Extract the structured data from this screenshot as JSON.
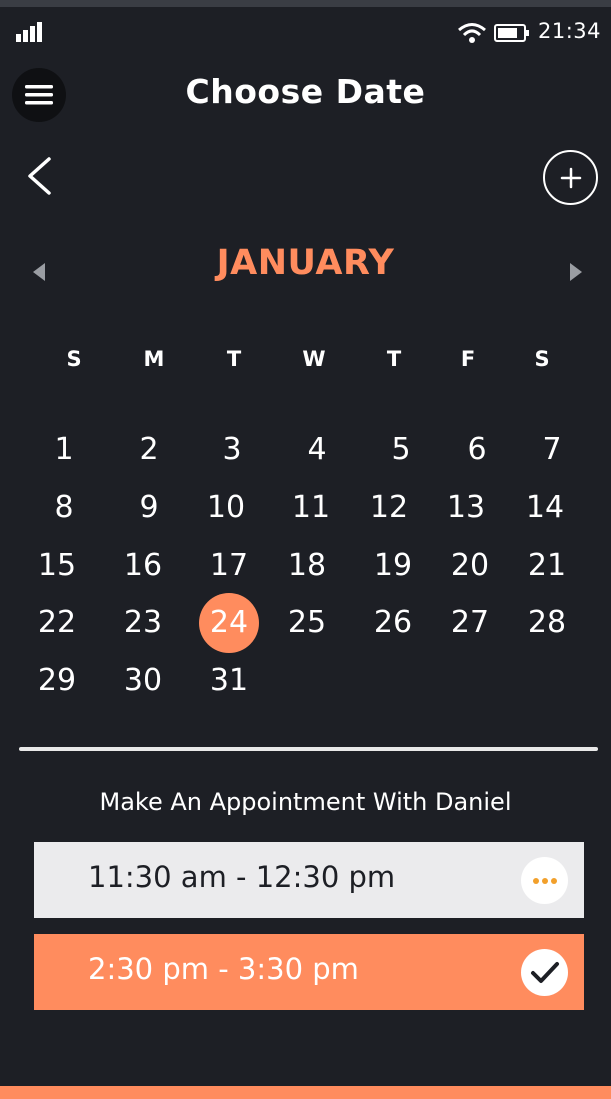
{
  "status_bar": {
    "time": "21:34"
  },
  "header": {
    "title": "Choose Date"
  },
  "calendar": {
    "month": "JANUARY",
    "weekdays": [
      "S",
      "M",
      "T",
      "W",
      "T",
      "F",
      "S"
    ],
    "days": [
      "1",
      "2",
      "3",
      "4",
      "5",
      "6",
      "7",
      "8",
      "9",
      "10",
      "11",
      "12",
      "13",
      "14",
      "15",
      "16",
      "17",
      "18",
      "19",
      "20",
      "21",
      "22",
      "23",
      "24",
      "25",
      "26",
      "27",
      "28",
      "29",
      "30",
      "31"
    ],
    "selected_day": "24"
  },
  "appointment": {
    "heading": "Make An Appointment With Daniel",
    "slots": [
      {
        "label": "11:30 am - 12:30 pm",
        "state": "options",
        "icon": "more-dots-icon"
      },
      {
        "label": "2:30 pm - 3:30 pm",
        "state": "selected",
        "icon": "check-icon"
      }
    ]
  },
  "colors": {
    "accent": "#ff8c5e",
    "background": "#1d1f25",
    "slot_default": "#ebebed"
  }
}
